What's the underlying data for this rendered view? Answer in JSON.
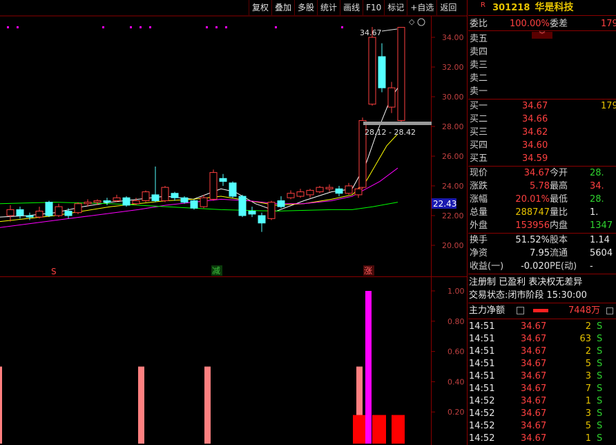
{
  "toolbar": {
    "buttons": [
      "复权",
      "叠加",
      "多股",
      "统计",
      "画线",
      "F10",
      "标记",
      "+自选",
      "返回"
    ]
  },
  "stock": {
    "marker": "R",
    "code": "301218",
    "name": "华是科技"
  },
  "candle_chart": {
    "y_ticks": [
      "34.00",
      "32.00",
      "30.00",
      "28.00",
      "26.00",
      "24.00",
      "22.00",
      "20.00"
    ],
    "price_tag": "22.43",
    "high_label": "34.67",
    "range_label": "28.12 - 28.42",
    "markers": [
      {
        "text": "S",
        "color": "#ff4040"
      },
      {
        "text": "减",
        "color": "#3fbf3f"
      },
      {
        "text": "涨",
        "color": "#ff6060"
      }
    ]
  },
  "indicator_chart": {
    "y_ticks": [
      "1.00",
      "0.80",
      "0.60",
      "0.40",
      "0.20"
    ]
  },
  "quote": {
    "weibi_label": "委比",
    "weibi": "100.00%",
    "weicha_label": "委差",
    "weicha": "179",
    "asks": [
      {
        "label": "卖五"
      },
      {
        "label": "卖四"
      },
      {
        "label": "卖三"
      },
      {
        "label": "卖二"
      },
      {
        "label": "卖一"
      }
    ],
    "bids": [
      {
        "label": "买一",
        "price": "34.67",
        "vol": "179"
      },
      {
        "label": "买二",
        "price": "34.66",
        "vol": ""
      },
      {
        "label": "买三",
        "price": "34.62",
        "vol": ""
      },
      {
        "label": "买四",
        "price": "34.60",
        "vol": ""
      },
      {
        "label": "买五",
        "price": "34.59",
        "vol": ""
      }
    ],
    "stats": [
      {
        "l1": "现价",
        "v1": "34.67",
        "l2": "今开",
        "v2": "28."
      },
      {
        "l1": "涨跌",
        "v1": "5.78",
        "l2": "最高",
        "v2": "34."
      },
      {
        "l1": "涨幅",
        "v1": "20.01%",
        "l2": "最低",
        "v2": "28."
      },
      {
        "l1": "总量",
        "v1": "288747",
        "l2": "量比",
        "v2": "1."
      },
      {
        "l1": "外盘",
        "v1": "153956",
        "l2": "内盘",
        "v2": "1347"
      }
    ],
    "stats2": [
      {
        "l1": "换手",
        "v1": "51.52%",
        "l2": "股本",
        "v2": "1.14"
      },
      {
        "l1": "净资",
        "v1": "7.95",
        "l2": "流通",
        "v2": "5604"
      },
      {
        "l1": "收益(一)",
        "v1": "-0.020",
        "l2": "PE(动)",
        "v2": "-"
      }
    ],
    "info1": "注册制 已盈利 表决权无差异",
    "info2_label": "交易状态:",
    "info2": "闭市阶段 15:30:00",
    "main_flow_label": "主力净额",
    "main_flow": "7448万"
  },
  "ticks": [
    {
      "time": "14:51",
      "price": "34.67",
      "vol": "2",
      "side": "S"
    },
    {
      "time": "14:51",
      "price": "34.67",
      "vol": "63",
      "side": "S"
    },
    {
      "time": "14:51",
      "price": "34.67",
      "vol": "2",
      "side": "S"
    },
    {
      "time": "14:51",
      "price": "34.67",
      "vol": "5",
      "side": "S"
    },
    {
      "time": "14:51",
      "price": "34.67",
      "vol": "3",
      "side": "S"
    },
    {
      "time": "14:51",
      "price": "34.67",
      "vol": "7",
      "side": "S"
    },
    {
      "time": "14:52",
      "price": "34.67",
      "vol": "1",
      "side": "S"
    },
    {
      "time": "14:52",
      "price": "34.67",
      "vol": "3",
      "side": "S"
    },
    {
      "time": "14:52",
      "price": "34.67",
      "vol": "5",
      "side": "S"
    },
    {
      "time": "14:52",
      "price": "34.67",
      "vol": "1",
      "side": "S"
    }
  ],
  "colors": {
    "up": "#ff4040",
    "down": "#54ffff",
    "grid": "#8b0000",
    "ma5": "#ffffff",
    "ma10": "#ffff00",
    "ma20": "#ff00ff",
    "ma60": "#00ff00"
  }
}
